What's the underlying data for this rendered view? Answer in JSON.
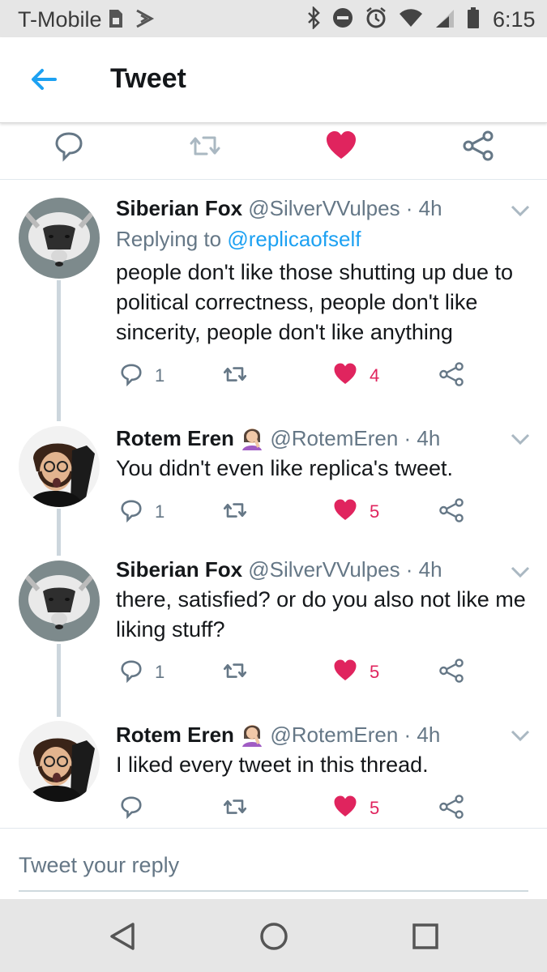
{
  "status_bar": {
    "carrier": "T-Mobile",
    "time": "6:15",
    "icons": [
      "sim-icon",
      "notification-icon",
      "bluetooth-icon",
      "do-not-disturb-icon",
      "alarm-icon",
      "wifi-icon",
      "signal-icon",
      "battery-icon"
    ]
  },
  "header": {
    "title": "Tweet",
    "back_icon": "back-arrow-icon"
  },
  "main_tweet_actions": {
    "icons": [
      "reply-icon",
      "retweet-icon",
      "heart-icon",
      "share-icon"
    ],
    "liked": true
  },
  "tweets": [
    {
      "name": "Siberian Fox",
      "meta": "@SilverVVulpes · 4h",
      "replying_prefix": "Replying to ",
      "replying_to": "@replicaofself",
      "text": "people don't like those shutting up due to political correctness, people don't like sincerity, people don't like anything",
      "replies": "1",
      "retweets": "",
      "likes": "4",
      "liked": true
    },
    {
      "name": "Rotem Eren",
      "meta": "@RotemEren · 4h",
      "text": "You didn't even like replica's tweet.",
      "replies": "1",
      "retweets": "",
      "likes": "5",
      "liked": true
    },
    {
      "name": "Siberian Fox",
      "meta": "@SilverVVulpes · 4h",
      "text": "there, satisfied? or do you also not like me liking stuff?",
      "replies": "1",
      "retweets": "",
      "likes": "5",
      "liked": true
    },
    {
      "name": "Rotem Eren",
      "meta": "@RotemEren · 4h",
      "text": "I liked every tweet in this thread.",
      "replies": "",
      "retweets": "",
      "likes": "5",
      "liked": true
    }
  ],
  "reply_box": {
    "placeholder": "Tweet your reply"
  },
  "nav_bar": {
    "icons": [
      "back-triangle-icon",
      "home-circle-icon",
      "recents-square-icon"
    ]
  },
  "colors": {
    "like": "#e0245e",
    "link": "#1da1f2",
    "muted": "#657786",
    "thread_line": "#ccd6dd"
  }
}
